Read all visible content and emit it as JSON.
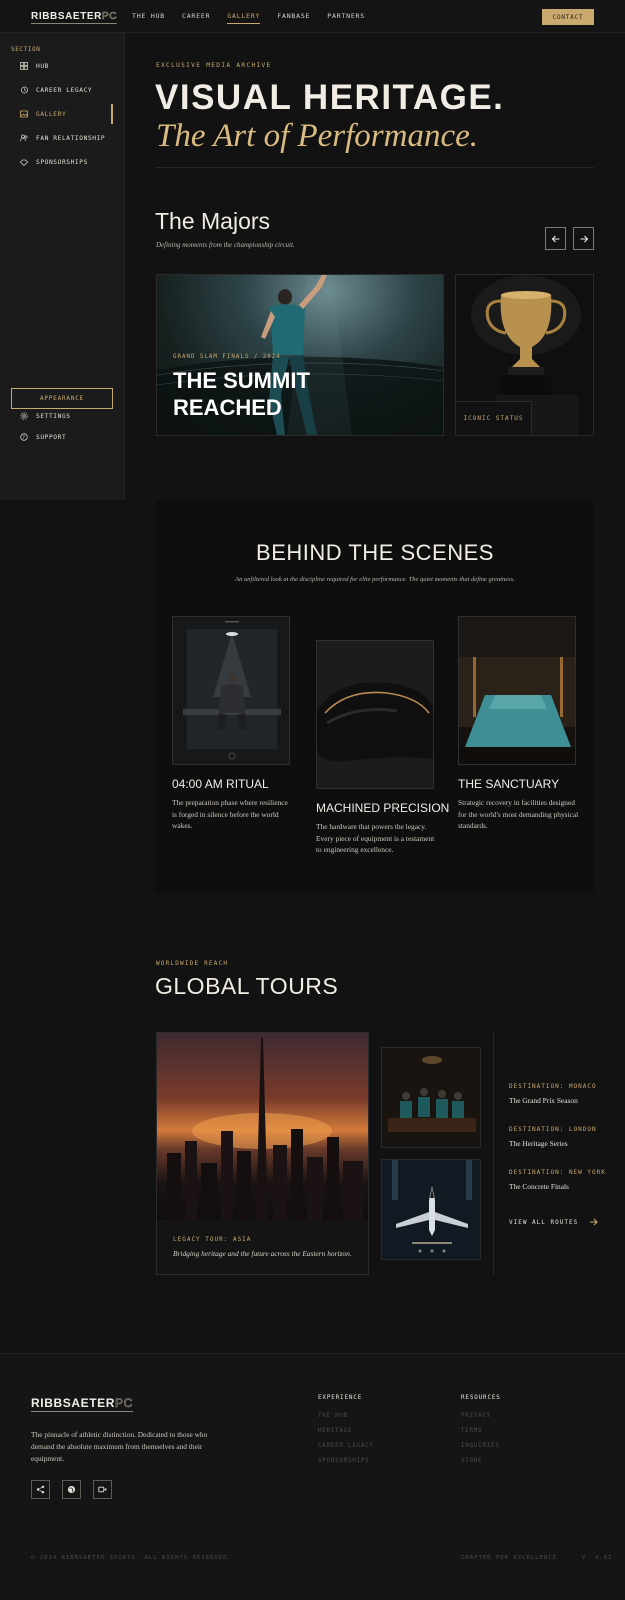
{
  "brand": {
    "name_solid": "RIBBSAETER",
    "name_outline": "PC"
  },
  "nav": {
    "links": [
      "THE HUB",
      "CAREER",
      "GALLERY",
      "FANBASE",
      "PARTNERS"
    ],
    "active": "GALLERY",
    "contact_label": "CONTACT"
  },
  "sidebar": {
    "section_label": "SECTION",
    "items": [
      {
        "label": "HUB",
        "icon": "grid-icon"
      },
      {
        "label": "CAREER LEGACY",
        "icon": "history-icon"
      },
      {
        "label": "GALLERY",
        "icon": "gallery-icon"
      },
      {
        "label": "FAN RELATIONSHIP",
        "icon": "people-icon"
      },
      {
        "label": "SPONSORSHIPS",
        "icon": "handshake-icon"
      }
    ],
    "appearance_label": "APPEARANCE",
    "settings_label": "SETTINGS",
    "support_label": "SUPPORT"
  },
  "hero": {
    "eyebrow": "EXCLUSIVE MEDIA ARCHIVE",
    "title": "VISUAL HERITAGE.",
    "subtitle": "The Art of Performance."
  },
  "majors": {
    "title": "The Majors",
    "subtitle": "Defining moments from the championship circuit.",
    "feature": {
      "tag": "GRAND SLAM FINALS / 2024",
      "title_line1": "THE SUMMIT",
      "title_line2": "REACHED"
    },
    "side_card_label": "ICONIC STATUS"
  },
  "behind": {
    "title": "BEHIND THE SCENES",
    "subtitle": "An unfiltered look at the discipline required for elite performance. The quiet moments that define greatness.",
    "items": [
      {
        "title": "04:00 AM RITUAL",
        "text": "The preparation phase where resilience is forged in silence before the world wakes."
      },
      {
        "title": "MACHINED PRECISION",
        "text": "The hardware that powers the legacy. Every piece of equipment is a testament to engineering excellence."
      },
      {
        "title": "THE SANCTUARY",
        "text": "Strategic recovery in facilities designed for the world's most demanding physical standards."
      }
    ]
  },
  "tours": {
    "eyebrow": "WORLDWIDE REACH",
    "title": "GLOBAL TOURS",
    "feature_tag": "LEGACY TOUR: ASIA",
    "feature_caption": "Bridging heritage and the future across the Eastern horizon.",
    "destinations": [
      {
        "key": "DESTINATION: MONACO",
        "value": "The Grand Prix Season"
      },
      {
        "key": "DESTINATION: LONDON",
        "value": "The Heritage Series"
      },
      {
        "key": "DESTINATION: NEW YORK",
        "value": "The Concrete Finals"
      }
    ],
    "view_all": "VIEW ALL ROUTES"
  },
  "footer": {
    "description": "The pinnacle of athletic distinction. Dedicated to those who demand the absolute maximum from themselves and their equipment.",
    "col1": {
      "heading": "EXPERIENCE",
      "links": [
        "THE HUB",
        "HERITAGE",
        "CAREER LEGACY",
        "SPONSORSHIPS"
      ]
    },
    "col2": {
      "heading": "RESOURCES",
      "links": [
        "PRIVACY",
        "TERMS",
        "INQUIRIES",
        "STORE"
      ]
    },
    "copyright": "© 2024 RIBBSAETER SPORTS. ALL RIGHTS RESERVED.",
    "crafted": "CRAFTED FOR EXCELLENCE",
    "version": "V. 4.02"
  },
  "colors": {
    "accent": "#c9a96e",
    "background": "#121212",
    "panel": "#1b1b1b"
  }
}
